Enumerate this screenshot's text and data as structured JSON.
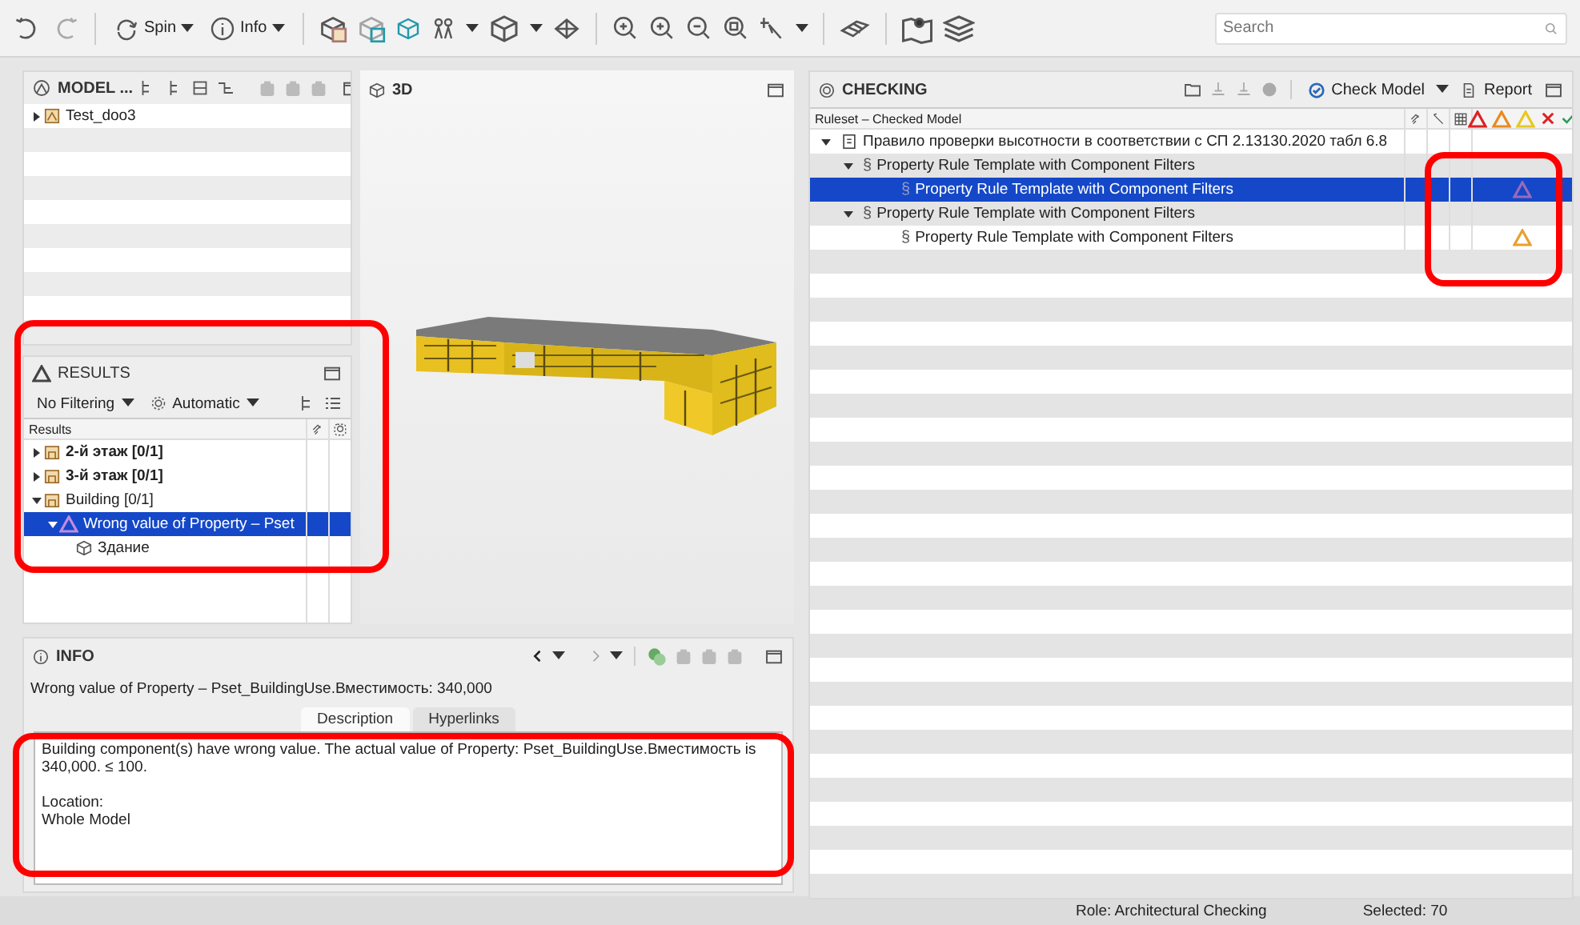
{
  "toolbar": {
    "spin": "Spin",
    "info": "Info",
    "search": {
      "placeholder": "Search"
    }
  },
  "model_panel": {
    "title": "MODEL ...",
    "tree": [
      {
        "label": "Test_doo3",
        "expanded": false,
        "selected": false
      }
    ]
  },
  "view_3d": {
    "title": "3D"
  },
  "results_panel": {
    "title": "RESULTS",
    "filter": "No Filtering",
    "mode": "Automatic",
    "column": "Results",
    "tree": [
      {
        "label": "2-й этаж [0/1]",
        "kind": "floor",
        "bold": true,
        "expanded": false,
        "selected": false
      },
      {
        "label": "3-й этаж [0/1]",
        "kind": "floor",
        "bold": true,
        "expanded": false,
        "selected": false
      },
      {
        "label": "Building [0/1]",
        "kind": "floor",
        "bold": false,
        "expanded": true,
        "selected": false,
        "children": [
          {
            "label": "Wrong value of Property – Pset",
            "kind": "issue",
            "bold": false,
            "expanded": true,
            "selected": true,
            "children": [
              {
                "label": "Здание",
                "kind": "component",
                "bold": false,
                "selected": false
              }
            ]
          }
        ]
      }
    ]
  },
  "info_panel": {
    "title": "INFO",
    "heading": "Wrong value of Property – Pset_BuildingUse.Вместимость: 340,000",
    "tabs": [
      {
        "label": "Description",
        "selected": true
      },
      {
        "label": "Hyperlinks",
        "selected": false
      }
    ],
    "description": [
      "Building component(s) have wrong value. The actual value of Property: Pset_BuildingUse.Вместимость is 340,000. ≤ 100.",
      "Location:\nWhole Model"
    ]
  },
  "checking_panel": {
    "title": "CHECKING",
    "check_button": "Check Model",
    "report_button": "Report",
    "column": "Ruleset – Checked Model",
    "tree": [
      {
        "label": "Правило проверки высотности в соответствии с СП 2.13130.2020 табл 6.8",
        "kind": "ruleset",
        "expanded": true,
        "selected": false,
        "warning": false,
        "children": [
          {
            "marker": "§",
            "label": "Property Rule Template with Component Filters",
            "kind": "rule",
            "expanded": true,
            "selected": false,
            "warning": false,
            "children": [
              {
                "marker": "§",
                "label": "Property Rule Template with Component Filters",
                "kind": "rule",
                "warning": true,
                "selected": true
              }
            ]
          },
          {
            "marker": "§",
            "label": "Property Rule Template with Component Filters",
            "kind": "rule",
            "expanded": true,
            "selected": false,
            "warning": false,
            "children": [
              {
                "marker": "§",
                "label": "Property Rule Template with Component Filters",
                "kind": "rule",
                "warning": true,
                "selected": false
              }
            ]
          }
        ]
      }
    ]
  },
  "status_bar": {
    "role": "Role: Architectural Checking",
    "selected": "Selected: 70"
  }
}
